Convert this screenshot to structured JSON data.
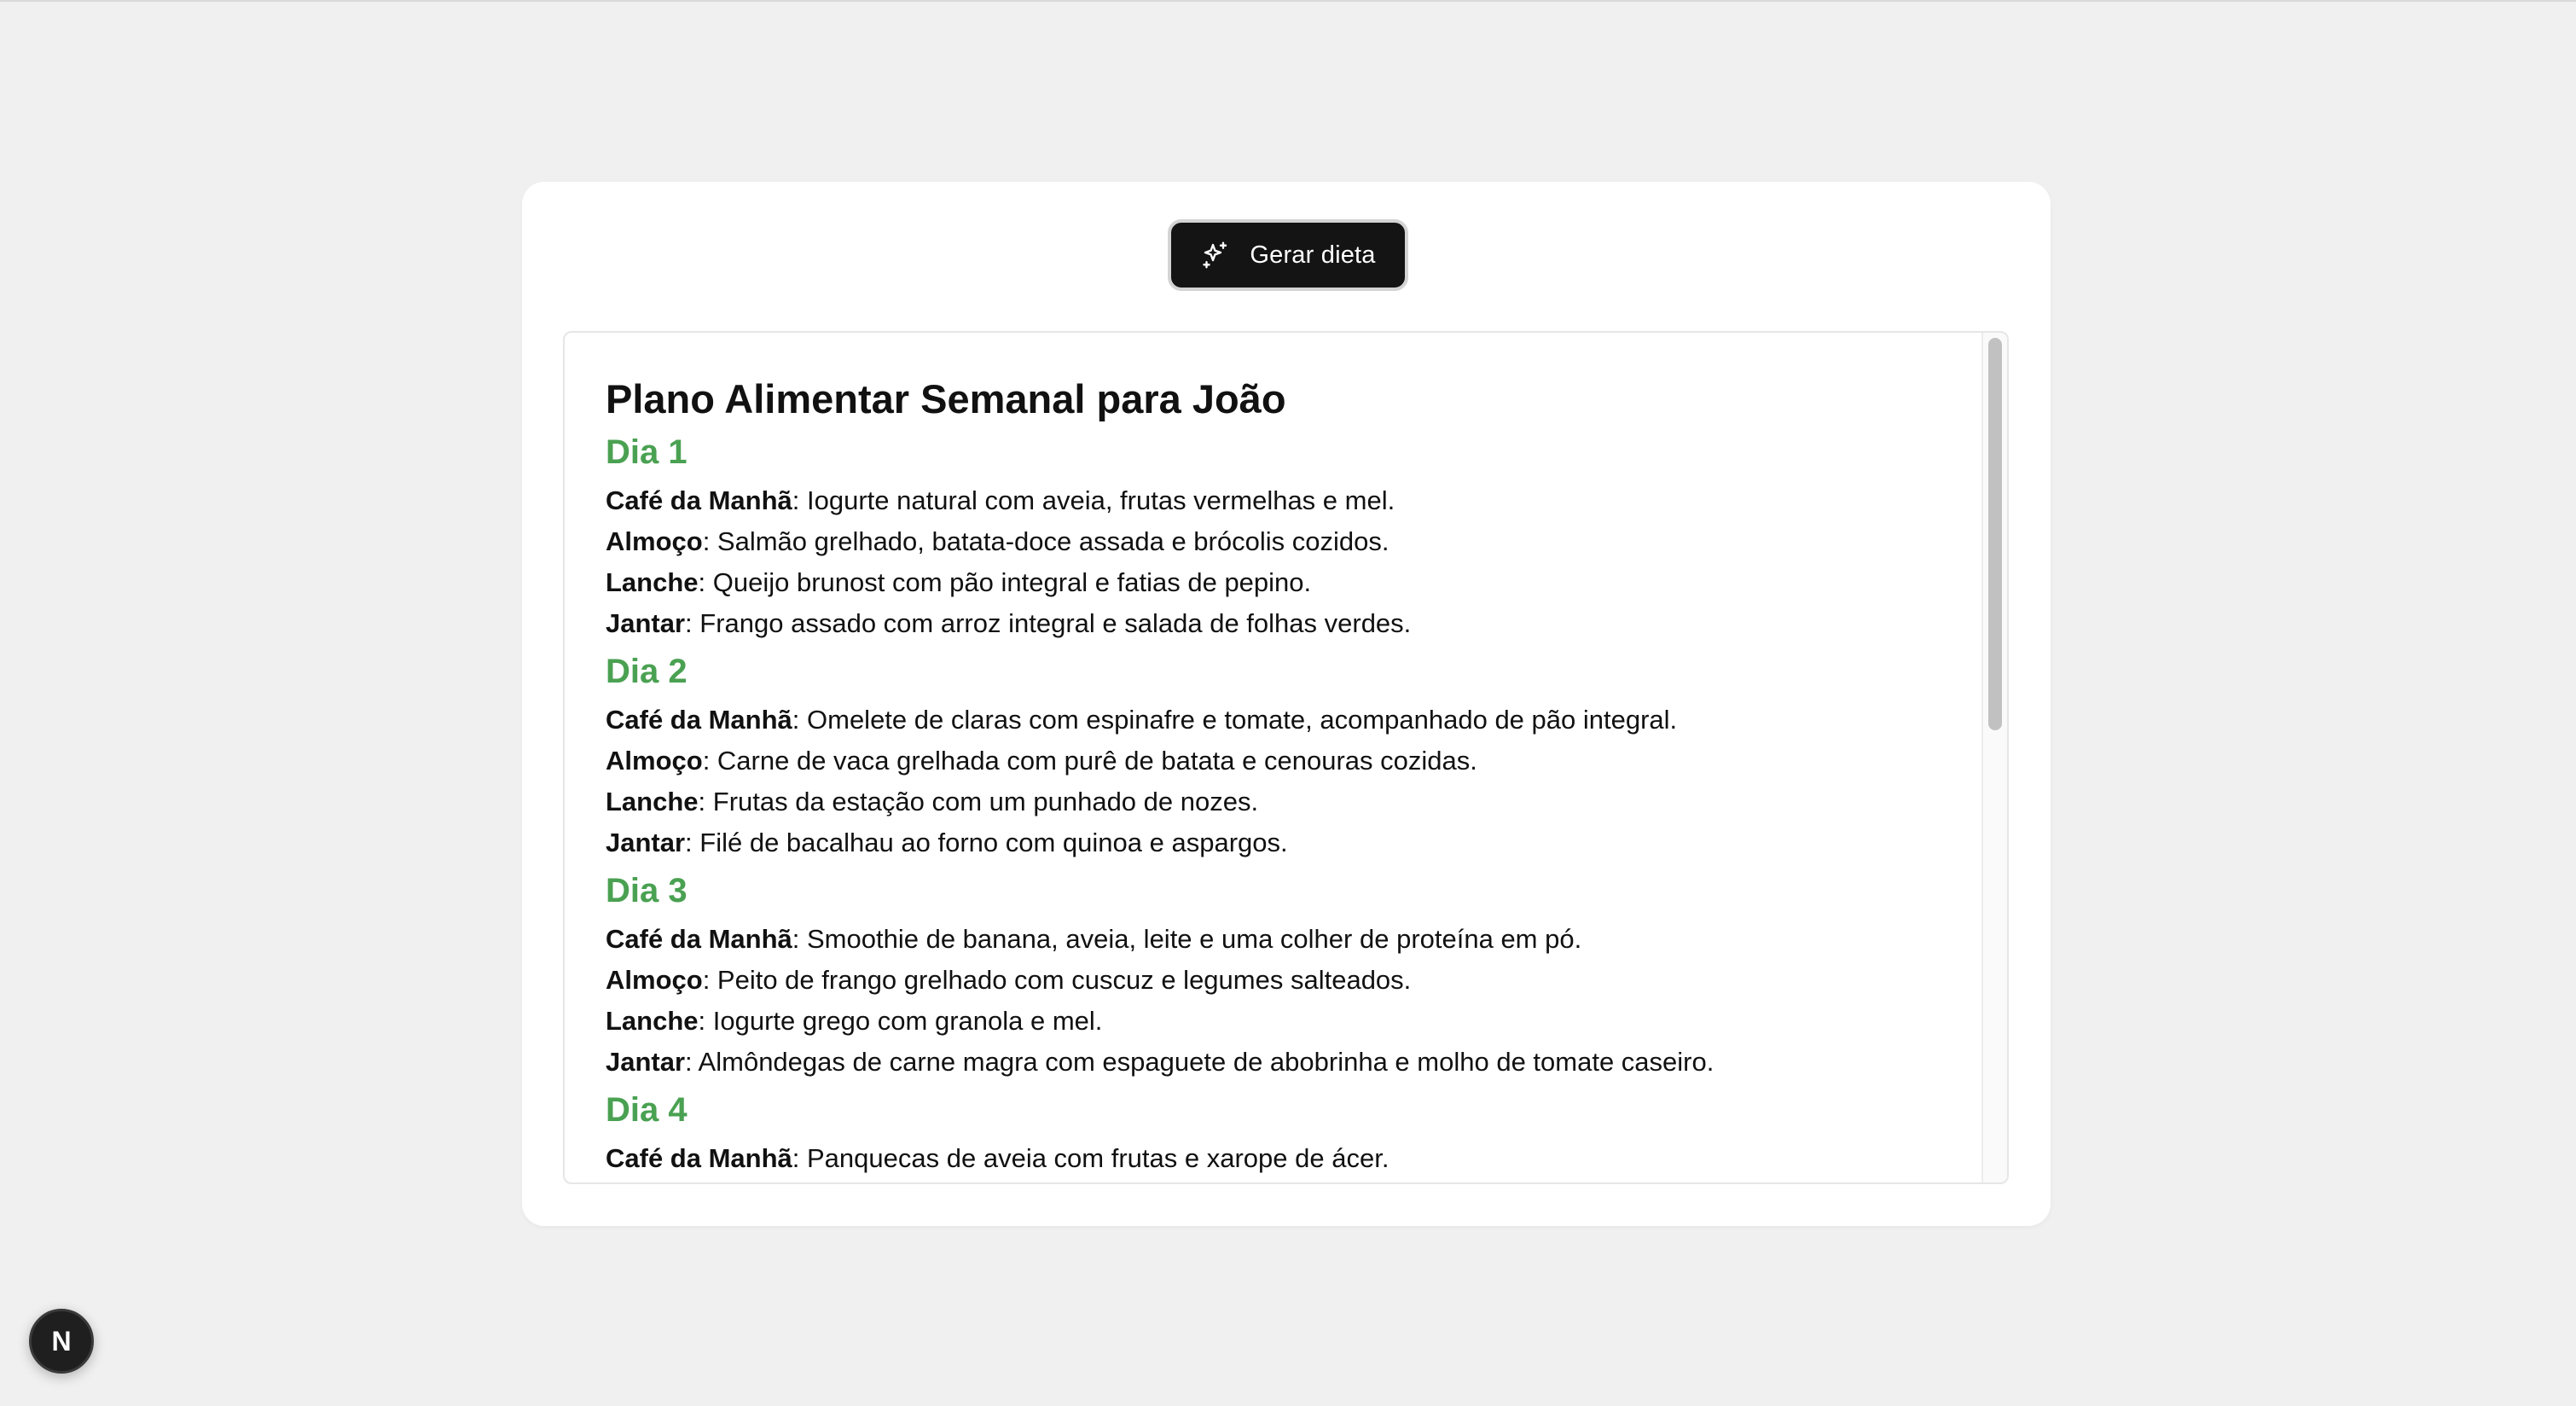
{
  "toolbar": {
    "generate_label": "Gerar dieta",
    "generate_icon": "sparkles-icon"
  },
  "diet": {
    "title": "Plano Alimentar Semanal para João",
    "heading_color": "#4aa152",
    "days": [
      {
        "heading": "Dia 1",
        "meals": [
          {
            "name": "Café da Manhã",
            "text": ": Iogurte natural com aveia, frutas vermelhas e mel."
          },
          {
            "name": "Almoço",
            "text": ": Salmão grelhado, batata-doce assada e brócolis cozidos."
          },
          {
            "name": "Lanche",
            "text": ": Queijo brunost com pão integral e fatias de pepino."
          },
          {
            "name": "Jantar",
            "text": ": Frango assado com arroz integral e salada de folhas verdes."
          }
        ]
      },
      {
        "heading": "Dia 2",
        "meals": [
          {
            "name": "Café da Manhã",
            "text": ": Omelete de claras com espinafre e tomate, acompanhado de pão integral."
          },
          {
            "name": "Almoço",
            "text": ": Carne de vaca grelhada com purê de batata e cenouras cozidas."
          },
          {
            "name": "Lanche",
            "text": ": Frutas da estação com um punhado de nozes."
          },
          {
            "name": "Jantar",
            "text": ": Filé de bacalhau ao forno com quinoa e aspargos."
          }
        ]
      },
      {
        "heading": "Dia 3",
        "meals": [
          {
            "name": "Café da Manhã",
            "text": ": Smoothie de banana, aveia, leite e uma colher de proteína em pó."
          },
          {
            "name": "Almoço",
            "text": ": Peito de frango grelhado com cuscuz e legumes salteados."
          },
          {
            "name": "Lanche",
            "text": ": Iogurte grego com granola e mel."
          },
          {
            "name": "Jantar",
            "text": ": Almôndegas de carne magra com espaguete de abobrinha e molho de tomate caseiro."
          }
        ]
      },
      {
        "heading": "Dia 4",
        "meals": [
          {
            "name": "Café da Manhã",
            "text": ": Panquecas de aveia com frutas e xarope de ácer."
          }
        ]
      }
    ]
  },
  "dev_badge": {
    "letter": "N"
  }
}
